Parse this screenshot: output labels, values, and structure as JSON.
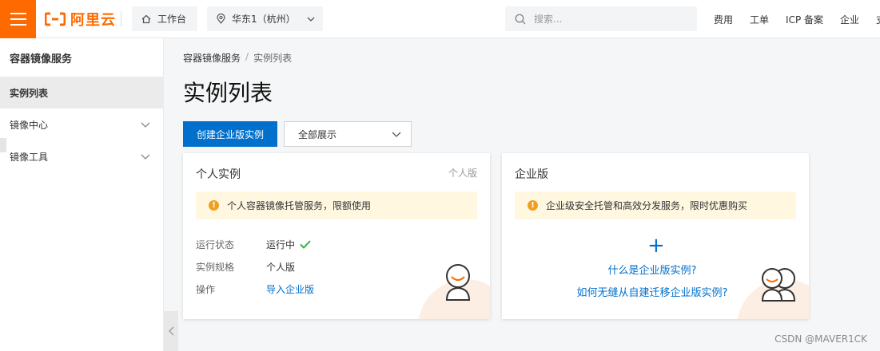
{
  "header": {
    "logo_text": "阿里云",
    "workbench_label": "工作台",
    "region_label": "华东1（杭州）",
    "search_placeholder": "搜索...",
    "links": [
      "费用",
      "工单",
      "ICP 备案",
      "企业",
      "支"
    ]
  },
  "sidebar": {
    "title": "容器镜像服务",
    "items": [
      {
        "label": "实例列表",
        "active": true
      },
      {
        "label": "镜像中心",
        "expandable": true
      },
      {
        "label": "镜像工具",
        "expandable": true
      }
    ]
  },
  "main": {
    "breadcrumb": [
      "容器镜像服务",
      "/",
      "实例列表"
    ],
    "title": "实例列表",
    "create_button": "创建企业版实例",
    "filter_select": "全部展示"
  },
  "personal_card": {
    "title": "个人实例",
    "tag": "个人版",
    "notice": "个人容器镜像托管服务，限额使用",
    "rows": [
      {
        "key": "运行状态",
        "value": "运行中"
      },
      {
        "key": "实例规格",
        "value": "个人版"
      },
      {
        "key": "操作",
        "value": "导入企业版"
      }
    ]
  },
  "enterprise_card": {
    "title": "企业版",
    "notice": "企业级安全托管和高效分发服务，限时优惠购买",
    "link1": "什么是企业版实例?",
    "link2": "如何无缝从自建迁移企业版实例?"
  },
  "watermark": "CSDN @MAVER1CK",
  "colors": {
    "brand": "#ff6a00",
    "primary": "#0070cc",
    "notice_bg": "#fff7e0",
    "success": "#2fb344"
  }
}
